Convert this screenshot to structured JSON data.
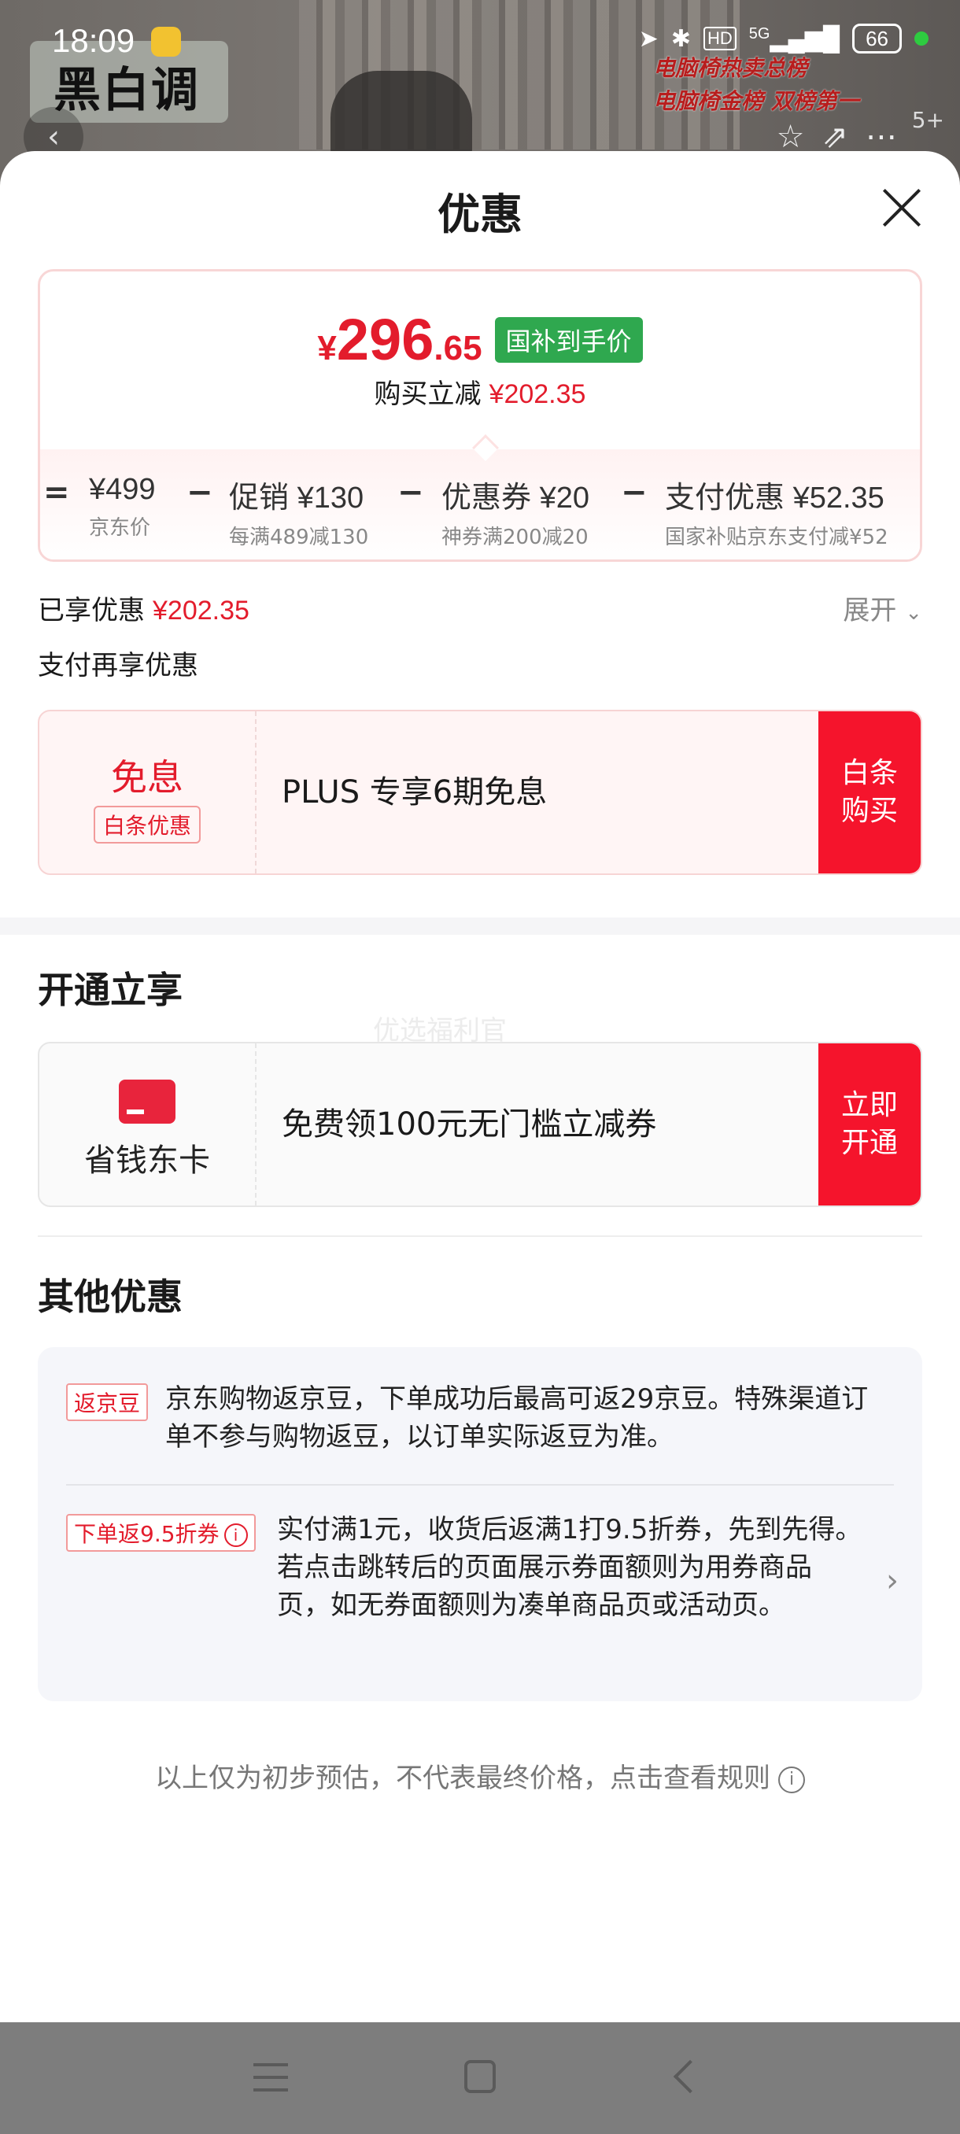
{
  "status_bar": {
    "time": "18:09",
    "network": "5G",
    "hd": "HD",
    "battery": "66"
  },
  "background_page": {
    "logo_text": "黑白调",
    "badge_line1": "电脑椅热卖总榜",
    "badge_line2": "电脑椅金榜 双榜第一",
    "image_count": "5+"
  },
  "sheet": {
    "title": "优惠",
    "price": {
      "currency": "¥",
      "integer": "296",
      "decimal": ".65",
      "tag": "国补到手价"
    },
    "reduce": {
      "label": "购买立减",
      "amount": "¥202.35"
    },
    "breakdown": [
      {
        "op": "=",
        "label": "",
        "value": "¥499",
        "sub": "京东价"
      },
      {
        "op": "−",
        "label": "促销",
        "value": "¥130",
        "sub": "每满489减130"
      },
      {
        "op": "−",
        "label": "优惠券",
        "value": "¥20",
        "sub": "神券满200减20"
      },
      {
        "op": "−",
        "label": "支付优惠",
        "value": "¥52.35",
        "sub": "国家补贴京东支付减¥52"
      }
    ],
    "enjoyed": {
      "label": "已享优惠",
      "amount": "¥202.35"
    },
    "expand_label": "展开",
    "pay_more_label": "支付再享优惠",
    "baitiao_offer": {
      "title": "免息",
      "tag": "白条优惠",
      "text": "PLUS 专享6期免息",
      "button_line1": "白条",
      "button_line2": "购买"
    },
    "open_section": {
      "title": "开通立享",
      "faint_text": "优选福利官",
      "card_label": "省钱东卡",
      "text": "免费领100元无门槛立减券",
      "button_line1": "立即",
      "button_line2": "开通"
    },
    "other_section": {
      "title": "其他优惠",
      "items": [
        {
          "tag": "返京豆",
          "text": "京东购物返京豆，下单成功后最高可返29京豆。特殊渠道订单不参与购物返豆，以订单实际返豆为准。"
        },
        {
          "tag": "下单返9.5折券",
          "text": "实付满1元，收货后返满1打9.5折券，先到先得。若点击跳转后的页面展示券面额则为用券商品页，如无券面额则为凑单商品页或活动页。"
        }
      ]
    },
    "disclaimer": "以上仅为初步预估，不代表最终价格，点击查看规则"
  },
  "colors": {
    "accent_red": "#e31c2c",
    "button_red": "#f5142c",
    "tag_green": "#2fa84f"
  }
}
